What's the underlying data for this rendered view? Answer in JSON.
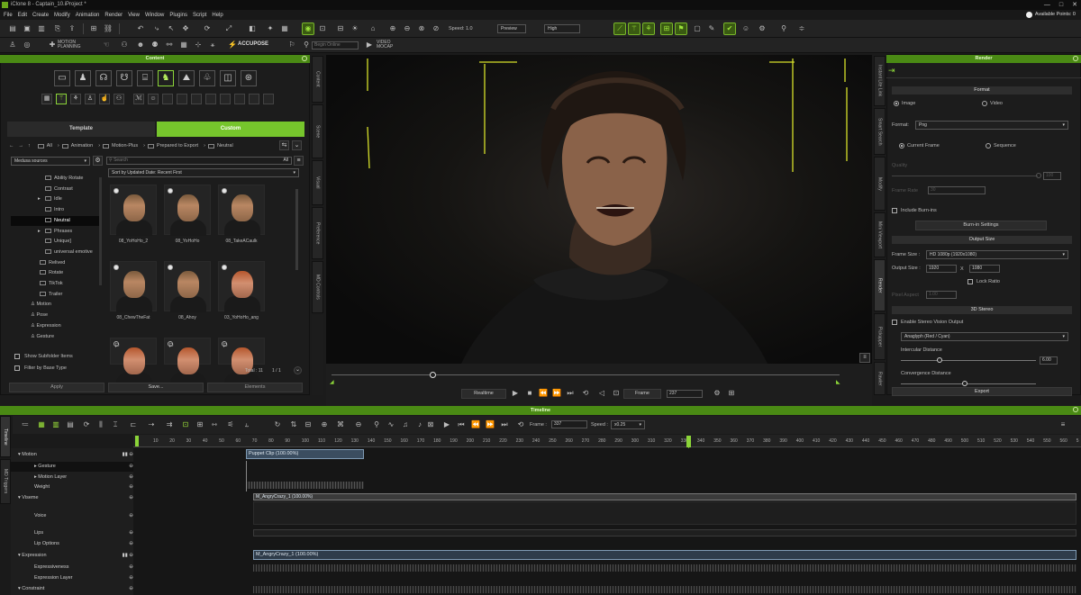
{
  "window": {
    "title": "iClone 8 - Captain_10.iProject *",
    "controls": [
      "—",
      "□",
      "✕"
    ]
  },
  "menu": [
    "File",
    "Edit",
    "Create",
    "Modify",
    "Animation",
    "Render",
    "View",
    "Window",
    "Plugins",
    "Script",
    "Help"
  ],
  "points": {
    "label": "Available Points: 0"
  },
  "toolbar": {
    "speed_label": "Speed: 1.0",
    "preview": "Preview",
    "quality": "High",
    "motion_planning": [
      "MOTION",
      "PLANNING"
    ],
    "accupose": "ACCUPOSE",
    "begin_online": "Begin Online",
    "video_mocap": [
      "VIDEO",
      "MOCAP"
    ]
  },
  "content": {
    "title": "Content",
    "tabs": [
      "Template",
      "Custom"
    ],
    "breadcrumb": [
      "All",
      "Animation",
      "Motion-Plus",
      "Prepared to Export",
      "Neutral"
    ],
    "source": "Medusa sources",
    "search_placeholder": "Search",
    "filter": "All",
    "sort": "Sort by Updated Date: Recent First",
    "tree": [
      {
        "label": "Ability Rotate",
        "indent": 2,
        "arrow": false
      },
      {
        "label": "Contrast",
        "indent": 2,
        "arrow": false
      },
      {
        "label": "Idle",
        "indent": 2,
        "arrow": true
      },
      {
        "label": "Intro",
        "indent": 2,
        "arrow": false
      },
      {
        "label": "Neutral",
        "indent": 2,
        "arrow": false,
        "selected": true
      },
      {
        "label": "Phrases",
        "indent": 2,
        "arrow": true
      },
      {
        "label": "Unique]",
        "indent": 2,
        "arrow": false
      },
      {
        "label": "universal emotive",
        "indent": 2,
        "arrow": false
      },
      {
        "label": "Relived",
        "indent": 1,
        "arrow": false
      },
      {
        "label": "Rotate",
        "indent": 1,
        "arrow": false
      },
      {
        "label": "TikTok",
        "indent": 1,
        "arrow": false
      },
      {
        "label": "Trailer",
        "indent": 1,
        "arrow": false
      },
      {
        "label": "Motion",
        "indent": 0,
        "arrow": false
      },
      {
        "label": "Pose",
        "indent": 0,
        "arrow": false
      },
      {
        "label": "Expression",
        "indent": 0,
        "arrow": false
      },
      {
        "label": "Gesture",
        "indent": 0,
        "arrow": false
      }
    ],
    "items": [
      {
        "label": "08_YoHoHo_2",
        "hair": "dark"
      },
      {
        "label": "08_YoHoHo",
        "hair": "dark"
      },
      {
        "label": "08_TakeACaulk",
        "hair": "dark"
      },
      {
        "label": "08_ChewTheFat",
        "hair": "dark"
      },
      {
        "label": "08_Ahoy",
        "hair": "dark"
      },
      {
        "label": "03_YoHoHo_ang",
        "hair": "red"
      },
      {
        "label": "",
        "hair": "red"
      },
      {
        "label": "",
        "hair": "red"
      },
      {
        "label": "",
        "hair": "red"
      }
    ],
    "total": "Total : 11",
    "pages": "1 / 1",
    "show_subfolder": "Show Subfolder Items",
    "filter_by_base": "Filter by Base Type",
    "buttons": [
      "Apply",
      "Save...",
      "Elements"
    ]
  },
  "side_tabs_left": [
    "Content",
    "Scene",
    "Visual",
    "Preference",
    "MD Controls"
  ],
  "side_tabs_right": [
    "Instant Lite Link",
    "Smart Search",
    "Modify",
    "Mini Viewport",
    "Render",
    "Pickupper",
    "Rawler"
  ],
  "playback": {
    "mode": "Realtime",
    "frame_label": "Frame",
    "frame": "237"
  },
  "render": {
    "title": "Render",
    "format_header": "Format",
    "image": "Image",
    "video": "Video",
    "format_label": "Format:",
    "format_value": "Png",
    "current_frame": "Current Frame",
    "sequence": "Sequence",
    "quality_label": "Quality",
    "quality_value": "100",
    "frame_rate_label": "Frame Rate",
    "frame_rate_value": "30",
    "include_burn_ins": "Include Burn-ins",
    "burn_in_settings": "Burn-in Settings",
    "output_size_header": "Output Size",
    "frame_size_label": "Frame Size :",
    "frame_size_value": "HD 1080p (1920x1080)",
    "output_size_label": "Output Size :",
    "width": "1920",
    "height": "1080",
    "x": "X",
    "lock_ratio": "Lock Ratio",
    "pixel_aspect_label": "Pixel Aspect",
    "pixel_aspect_value": "1.00",
    "stereo_header": "3D Stereo",
    "enable_stereo": "Enable Stereo Vision Output",
    "anaglyph": "Anaglyph (Red / Cyan)",
    "intercular": "Intercular Distance",
    "intercular_value": "6.00",
    "convergence": "Convergence Distance",
    "convergence_value": "200",
    "export": "Export"
  },
  "timeline": {
    "title": "Timeline",
    "frame_label": "Frame :",
    "frame": "337",
    "speed_label": "Speed :",
    "speed": "x0.25",
    "side_tabs": [
      "Timeline",
      "MD Triggers"
    ],
    "ruler": [
      "10",
      "20",
      "30",
      "40",
      "50",
      "60",
      "70",
      "80",
      "90",
      "100",
      "110",
      "120",
      "130",
      "140",
      "150",
      "160",
      "170",
      "180",
      "190",
      "200",
      "210",
      "220",
      "230",
      "240",
      "250",
      "260",
      "270",
      "280",
      "290",
      "300",
      "310",
      "320",
      "330",
      "340",
      "350",
      "360",
      "370",
      "380",
      "390",
      "400",
      "410",
      "420",
      "430",
      "440",
      "450",
      "460",
      "470",
      "480",
      "490",
      "500",
      "510",
      "520",
      "530",
      "540",
      "550",
      "560",
      "5"
    ],
    "tracks": [
      {
        "label": "Motion",
        "level": 0,
        "arrow": true
      },
      {
        "label": "Gesture",
        "level": 1,
        "arrow": true
      },
      {
        "label": "Motion Layer",
        "level": 1,
        "arrow": true
      },
      {
        "label": "Weight",
        "level": 1,
        "arrow": false
      },
      {
        "label": "Viseme",
        "level": 0,
        "arrow": true
      },
      {
        "label": "Voice",
        "level": 1,
        "arrow": false
      },
      {
        "label": "Lips",
        "level": 1,
        "arrow": false
      },
      {
        "label": "Lip Options",
        "level": 1,
        "arrow": false
      },
      {
        "label": "Expression",
        "level": 0,
        "arrow": true
      },
      {
        "label": "Expressiveness",
        "level": 1,
        "arrow": false
      },
      {
        "label": "Expression Layer",
        "level": 1,
        "arrow": false
      },
      {
        "label": "Constraint",
        "level": 0,
        "arrow": true
      }
    ],
    "clips": {
      "puppet": "Puppet Clip (100.00%)",
      "viseme": "M_AngryCrazy_1 (100.00%)",
      "expression": "M_AngryCrazy_1 (100.00%)"
    }
  },
  "colors": {
    "accent": "#4a8a14",
    "highlight": "#8bd438",
    "playhead": "#8bd438"
  }
}
